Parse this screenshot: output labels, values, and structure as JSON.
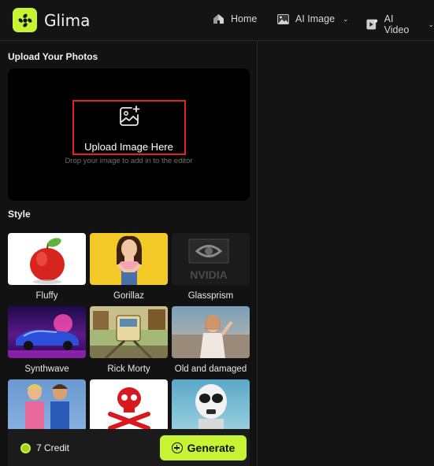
{
  "brand": {
    "name": "Glima"
  },
  "nav": [
    {
      "label": "Home",
      "icon": "home-icon"
    },
    {
      "label": "AI Image",
      "icon": "image-icon"
    },
    {
      "label": "AI Video",
      "icon": "video-icon"
    }
  ],
  "upload": {
    "section_title": "Upload Your Photos",
    "label": "Upload Image Here",
    "hint": "Drop your image to add in to the editor"
  },
  "style": {
    "section_title": "Style",
    "items": [
      {
        "label": "Fluffy"
      },
      {
        "label": "Gorillaz"
      },
      {
        "label": "Glassprism",
        "thumb_text": "NVIDIA"
      },
      {
        "label": "Synthwave"
      },
      {
        "label": "Rick Morty"
      },
      {
        "label": "Old and damaged"
      },
      {
        "label": ""
      },
      {
        "label": ""
      },
      {
        "label": ""
      }
    ]
  },
  "footer": {
    "credits": "7 Credit",
    "generate_label": "Generate"
  },
  "colors": {
    "accent": "#c6f432",
    "highlight": "#e0231d",
    "background": "#121212"
  }
}
